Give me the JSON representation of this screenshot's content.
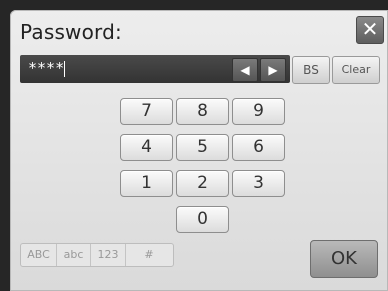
{
  "dialog": {
    "title": "Password:",
    "close_label": "✕"
  },
  "input": {
    "masked_value": "****"
  },
  "nav": {
    "left_label": "◀",
    "right_label": "▶"
  },
  "edit": {
    "bs_label": "BS",
    "clear_label": "Clear"
  },
  "keypad": {
    "keys": [
      "7",
      "8",
      "9",
      "4",
      "5",
      "6",
      "1",
      "2",
      "3",
      "0"
    ]
  },
  "modes": [
    "ABC",
    "abc",
    "123",
    "#"
  ],
  "ok_label": "OK"
}
